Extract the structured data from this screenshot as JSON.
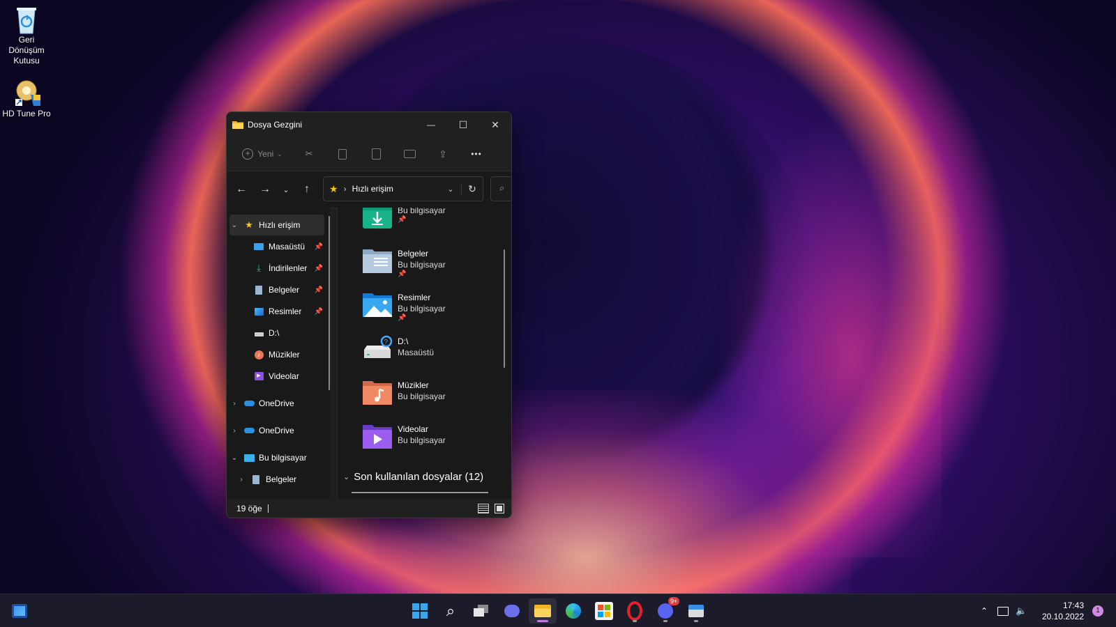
{
  "desktop": {
    "icons": [
      {
        "label": "Geri Dönüşüm Kutusu",
        "icon": "recycle-bin-icon"
      },
      {
        "label": "HD Tune Pro",
        "icon": "hd-tune-icon"
      }
    ]
  },
  "window": {
    "title": "Dosya Gezgini",
    "controls": {
      "minimize": "—",
      "maximize": "☐",
      "close": "✕"
    },
    "command_bar": {
      "new_label": "Yeni",
      "more": "•••"
    },
    "address": {
      "location": "Hızlı erişim",
      "separator": "›"
    },
    "sidebar": {
      "quick_access": "Hızlı erişim",
      "items": [
        {
          "label": "Masaüstü",
          "pinned": true
        },
        {
          "label": "İndirilenler",
          "pinned": true
        },
        {
          "label": "Belgeler",
          "pinned": true
        },
        {
          "label": "Resimler",
          "pinned": true
        },
        {
          "label": "D:\\",
          "pinned": false
        },
        {
          "label": "Müzikler",
          "pinned": false
        },
        {
          "label": "Videolar",
          "pinned": false
        }
      ],
      "onedrive1": "OneDrive",
      "onedrive2": "OneDrive",
      "this_pc": "Bu bilgisayar",
      "this_pc_child": "Belgeler"
    },
    "content": {
      "tiles": [
        {
          "name": "",
          "sub": "Bu bilgisayar",
          "pinned": true,
          "icon": "downloads-folder-icon"
        },
        {
          "name": "Belgeler",
          "sub": "Bu bilgisayar",
          "pinned": true,
          "icon": "documents-folder-icon"
        },
        {
          "name": "Resimler",
          "sub": "Bu bilgisayar",
          "pinned": true,
          "icon": "pictures-folder-icon"
        },
        {
          "name": "D:\\",
          "sub": "Masaüstü",
          "pinned": false,
          "icon": "drive-icon"
        },
        {
          "name": "Müzikler",
          "sub": "Bu bilgisayar",
          "pinned": false,
          "icon": "music-folder-icon"
        },
        {
          "name": "Videolar",
          "sub": "Bu bilgisayar",
          "pinned": false,
          "icon": "videos-folder-icon"
        }
      ],
      "recent_section": "Son kullanılan dosyalar (12)"
    },
    "status": {
      "count": "19 öğe"
    }
  },
  "taskbar": {
    "clock": {
      "time": "17:43",
      "date": "20.10.2022"
    },
    "discord_badge": "9+",
    "notification_count": "1"
  }
}
